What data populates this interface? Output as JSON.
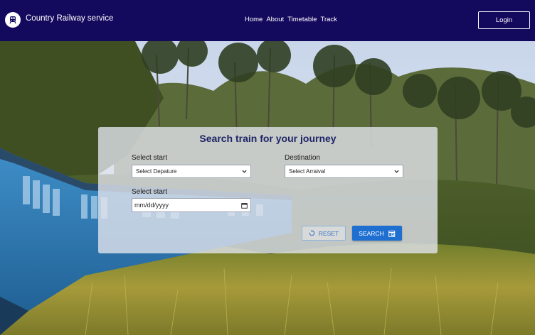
{
  "header": {
    "brand": "Country Railway service",
    "logo_icon": "train-icon",
    "nav": [
      {
        "label": "Home"
      },
      {
        "label": "About"
      },
      {
        "label": "Timetable"
      },
      {
        "label": "Track"
      }
    ],
    "login_label": "Login"
  },
  "search": {
    "title": "Search train for your journey",
    "start_label": "Select start",
    "start_value": "Select Depature",
    "destination_label": "Destination",
    "destination_value": "Select Arraival",
    "date_label": "Select start",
    "date_placeholder": "mm/dd/yyyy",
    "reset_label": "RESET",
    "search_label": "SEARCH"
  },
  "colors": {
    "header_bg": "#130a5e",
    "title": "#1e2466",
    "search_button": "#1f6fd1",
    "reset_text": "#3d73c4"
  }
}
